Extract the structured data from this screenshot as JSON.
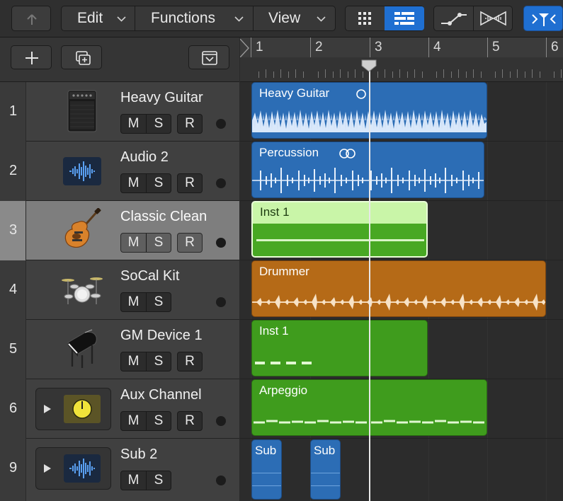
{
  "toolbar": {
    "edit": "Edit",
    "functions": "Functions",
    "view": "View"
  },
  "ruler": {
    "bars": [
      "1",
      "2",
      "3",
      "4",
      "5",
      "6"
    ]
  },
  "tracks": [
    {
      "number": "1",
      "name": "Heavy Guitar",
      "icon": "amp-icon",
      "buttons": [
        "M",
        "S",
        "R"
      ]
    },
    {
      "number": "2",
      "name": "Audio 2",
      "icon": "waveform-icon",
      "buttons": [
        "M",
        "S",
        "R"
      ]
    },
    {
      "number": "3",
      "name": "Classic Clean",
      "icon": "electric-guitar-icon",
      "buttons": [
        "M",
        "S",
        "R"
      ],
      "selected": true
    },
    {
      "number": "4",
      "name": "SoCal Kit",
      "icon": "drum-kit-icon",
      "buttons": [
        "M",
        "S"
      ]
    },
    {
      "number": "5",
      "name": "GM Device 1",
      "icon": "grand-piano-icon",
      "buttons": [
        "M",
        "S",
        "R"
      ]
    },
    {
      "number": "6",
      "name": "Aux Channel",
      "icon": "knob-icon",
      "buttons": [
        "M",
        "S",
        "R"
      ]
    },
    {
      "number": "9",
      "name": "Sub 2",
      "icon": "waveform-icon",
      "buttons": [
        "M",
        "S"
      ]
    }
  ],
  "regions": {
    "r1": {
      "name": "Heavy Guitar",
      "color": "#2c6db5"
    },
    "r2": {
      "name": "Percussion",
      "color": "#2c6db5"
    },
    "r3": {
      "name": "Inst 1",
      "color": "#c9f5a8"
    },
    "r4": {
      "name": "Drummer",
      "color": "#b56a17"
    },
    "r5": {
      "name": "Inst 1",
      "color": "#3f9c1d"
    },
    "r6": {
      "name": "Arpeggio",
      "color": "#3f9c1d"
    },
    "r7a": {
      "name": "Sub",
      "color": "#2c6db5"
    },
    "r7b": {
      "name": "Sub",
      "color": "#2c6db5"
    }
  },
  "playhead_position_bar": 3,
  "colors": {
    "accent_blue": "#1f6fd1",
    "region_blue": "#2c6db5",
    "region_green": "#3f9c1d",
    "region_orange": "#b56a17"
  }
}
